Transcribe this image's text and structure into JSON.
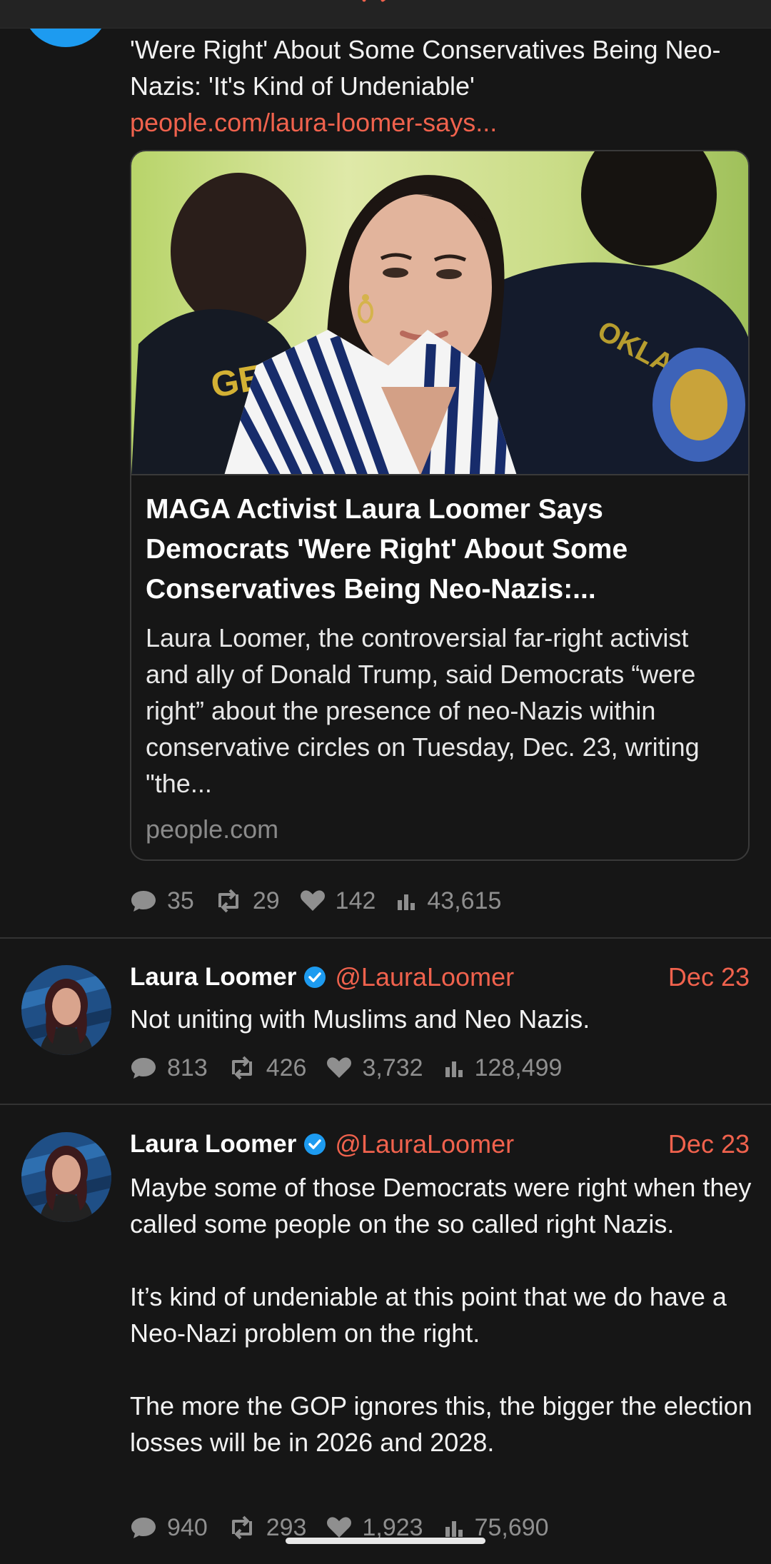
{
  "previous_post": {
    "text": "'Were Right' About Some Conservatives Being Neo-Nazis: 'It's Kind of Undeniable'",
    "link": "people.com/laura-loomer-says...",
    "card": {
      "title": "MAGA Activist Laura Loomer Says Democrats 'Were Right' About Some Conservatives Being Neo-Nazis:...",
      "description": "Laura Loomer, the controversial far-right activist and ally of Donald Trump, said Democrats “were right” about the presence of neo-Nazis within conservative circles on Tuesday, Dec. 23, writing \"the...",
      "domain": "people.com"
    },
    "stats": {
      "replies": "35",
      "reposts": "29",
      "likes": "142",
      "views": "43,615"
    }
  },
  "posts": [
    {
      "name": "Laura Loomer",
      "handle": "@LauraLoomer",
      "date": "Dec 23",
      "text": "Not uniting with Muslims and Neo Nazis.",
      "stats": {
        "replies": "813",
        "reposts": "426",
        "likes": "3,732",
        "views": "128,499"
      }
    },
    {
      "name": "Laura Loomer",
      "handle": "@LauraLoomer",
      "date": "Dec 23",
      "text": "Maybe some of those Democrats were right when they called some people on the so called right Nazis.\n\nIt’s kind of undeniable at this point that we do have a Neo-Nazi problem on the right.\n\nThe more the GOP ignores this, the bigger the election losses will be in 2026 and 2028.",
      "stats": {
        "replies": "940",
        "reposts": "293",
        "likes": "1,923",
        "views": "75,690"
      }
    }
  ],
  "icons": {
    "reply": "speech-bubble-icon",
    "repost": "repost-arrows-icon",
    "like": "heart-icon",
    "views": "bar-chart-icon",
    "verified": "verified-badge-icon"
  },
  "colors": {
    "background": "#161616",
    "accent": "#f0624d",
    "muted": "#8f8f8f",
    "verified": "#1d9bf0"
  }
}
